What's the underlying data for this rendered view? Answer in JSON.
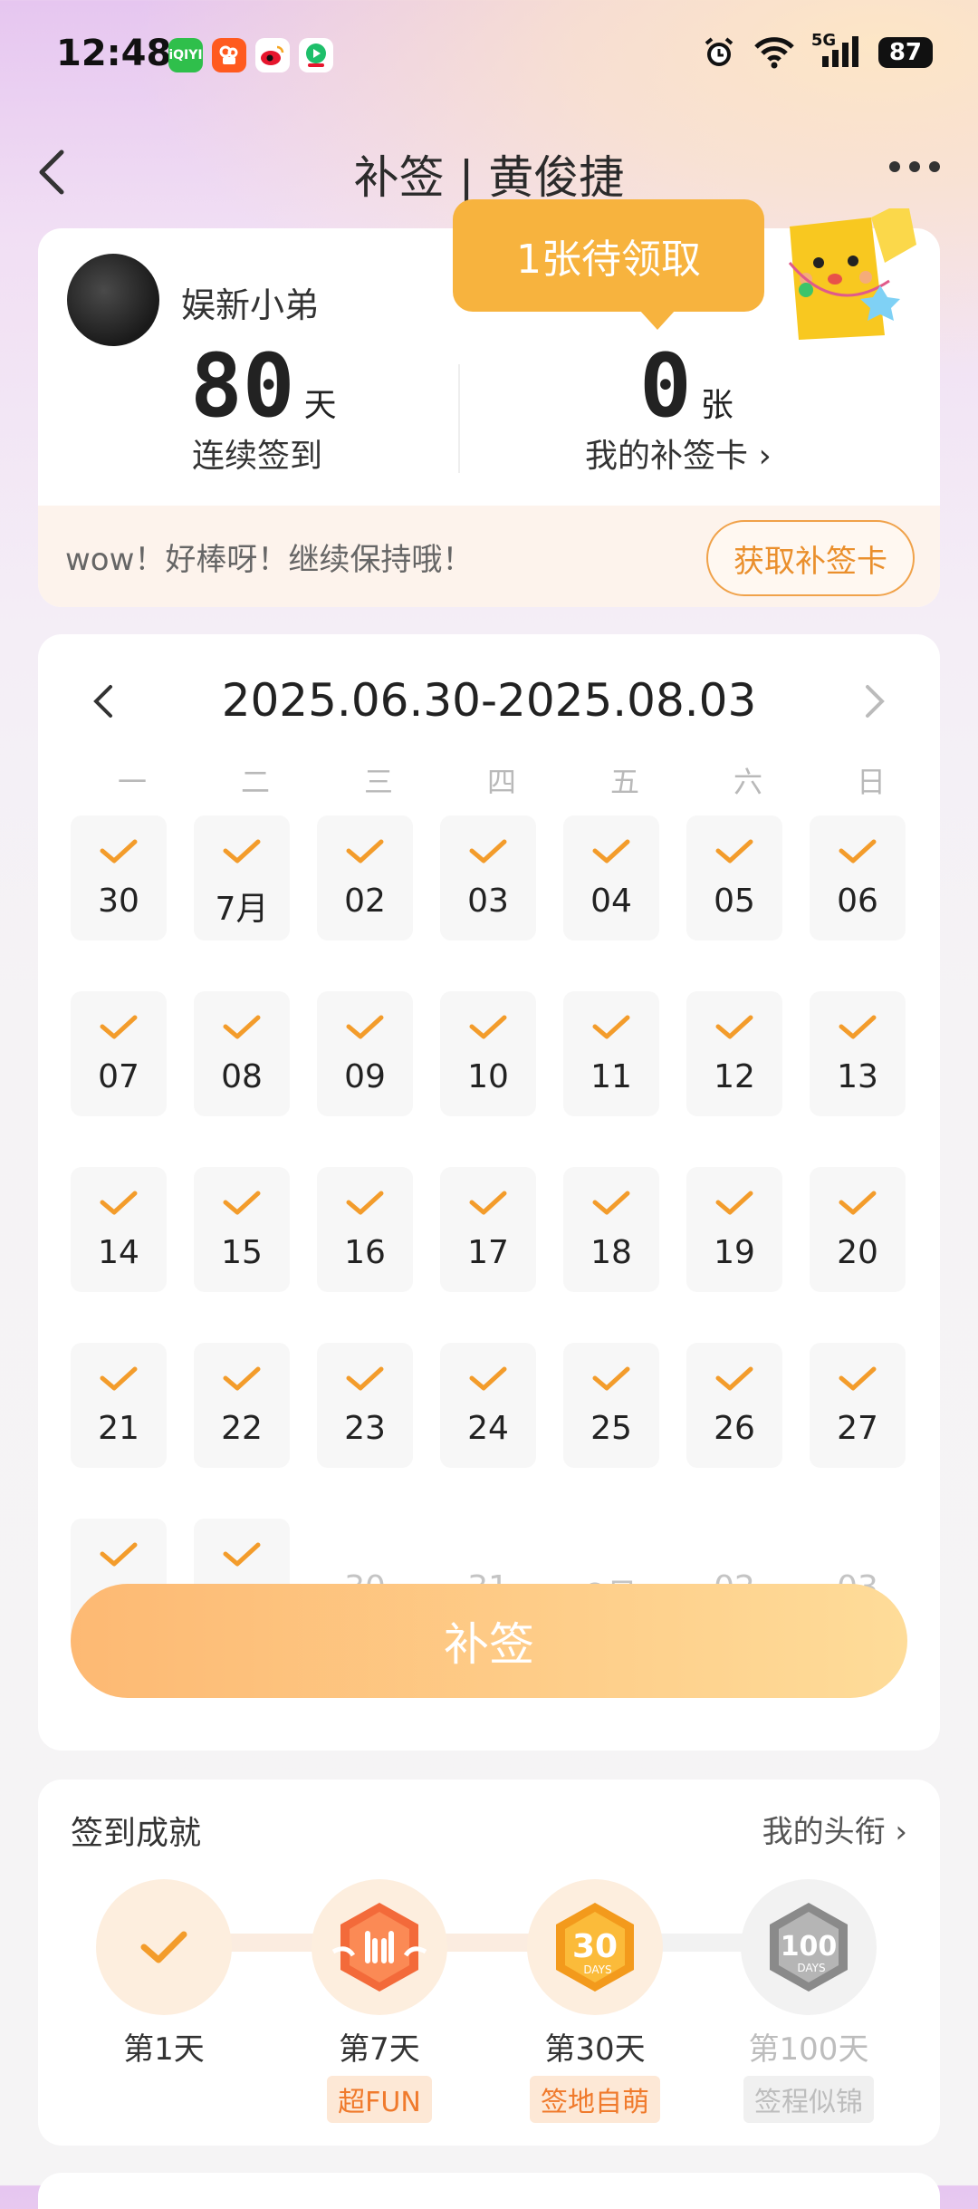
{
  "status_bar": {
    "time": "12:48",
    "apps": [
      {
        "name": "iqiyi-icon",
        "label": "iQIYI",
        "color": "#2fbf4b"
      },
      {
        "name": "kuaishou-icon",
        "label": "",
        "color": "#ff5a1f"
      },
      {
        "name": "weibo-icon",
        "label": "",
        "color": "#e6162d"
      },
      {
        "name": "video-icon",
        "label": "",
        "color": "#1ebf6a"
      }
    ],
    "network": "5G",
    "battery": "87"
  },
  "header": {
    "title": "补签 | 黄俊捷"
  },
  "profile": {
    "username": "娱新小弟",
    "streak_value": "80",
    "streak_unit": "天",
    "streak_label": "连续签到",
    "cards_value": "0",
    "cards_unit": "张",
    "cards_label": "我的补签卡 ›",
    "tooltip": "1张待领取",
    "message": "wow！好棒呀！继续保持哦！",
    "get_card_button": "获取补签卡"
  },
  "calendar": {
    "range": "2025.06.30-2025.08.03",
    "weekdays": [
      "一",
      "二",
      "三",
      "四",
      "五",
      "六",
      "日"
    ],
    "checked_days": [
      "30",
      "7月",
      "02",
      "03",
      "04",
      "05",
      "06",
      "07",
      "08",
      "09",
      "10",
      "11",
      "12",
      "13",
      "14",
      "15",
      "16",
      "17",
      "18",
      "19",
      "20",
      "21",
      "22",
      "23",
      "24",
      "25",
      "26",
      "27",
      "28",
      "今"
    ],
    "future_days": [
      "30",
      "31",
      "8月",
      "02",
      "03"
    ],
    "button": "补签",
    "accent": "#f39c2b"
  },
  "achievements": {
    "title": "签到成就",
    "link": "我的头衔 ›",
    "items": [
      {
        "label": "第1天",
        "tag": "",
        "state": "done"
      },
      {
        "label": "第7天",
        "tag": "超FUN",
        "state": "done"
      },
      {
        "label": "第30天",
        "tag": "签地自萌",
        "state": "done"
      },
      {
        "label": "第100天",
        "tag": "签程似锦",
        "state": "locked"
      }
    ]
  }
}
